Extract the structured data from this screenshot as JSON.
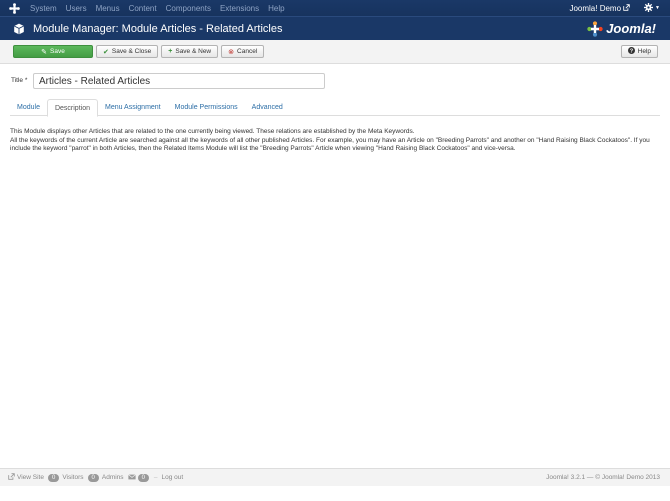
{
  "navbar": {
    "items": [
      "System",
      "Users",
      "Menus",
      "Content",
      "Components",
      "Extensions",
      "Help"
    ],
    "site_name": "Joomla! Demo"
  },
  "header": {
    "title": "Module Manager: Module Articles - Related Articles",
    "brand": "Joomla!"
  },
  "toolbar": {
    "save": "Save",
    "save_close": "Save & Close",
    "save_new": "Save & New",
    "cancel": "Cancel",
    "help": "Help"
  },
  "form": {
    "title_label": "Title *",
    "title_value": "Articles - Related Articles"
  },
  "tabs": [
    "Module",
    "Description",
    "Menu Assignment",
    "Module Permissions",
    "Advanced"
  ],
  "active_tab": "Description",
  "description": {
    "line1": "This Module displays other Articles that are related to the one currently being viewed. These relations are established by the Meta Keywords.",
    "line2": "All the keywords of the current Article are searched against all the keywords of all other published Articles. For example, you may have an Article on \"Breeding Parrots\" and another on \"Hand Raising Black Cockatoos\". If you include the keyword \"parrot\" in both Articles, then the Related Items Module will list the \"Breeding Parrots\" Article when viewing \"Hand Raising Black Cockatoos\" and vice-versa."
  },
  "footer": {
    "view_site": "View Site",
    "visitors_count": "0",
    "visitors": "Visitors",
    "admins_count": "0",
    "admins": "Admins",
    "messages_count": "0",
    "logout": "Log out",
    "copyright": "Joomla! 3.2.1 — © Joomla! Demo 2013"
  }
}
